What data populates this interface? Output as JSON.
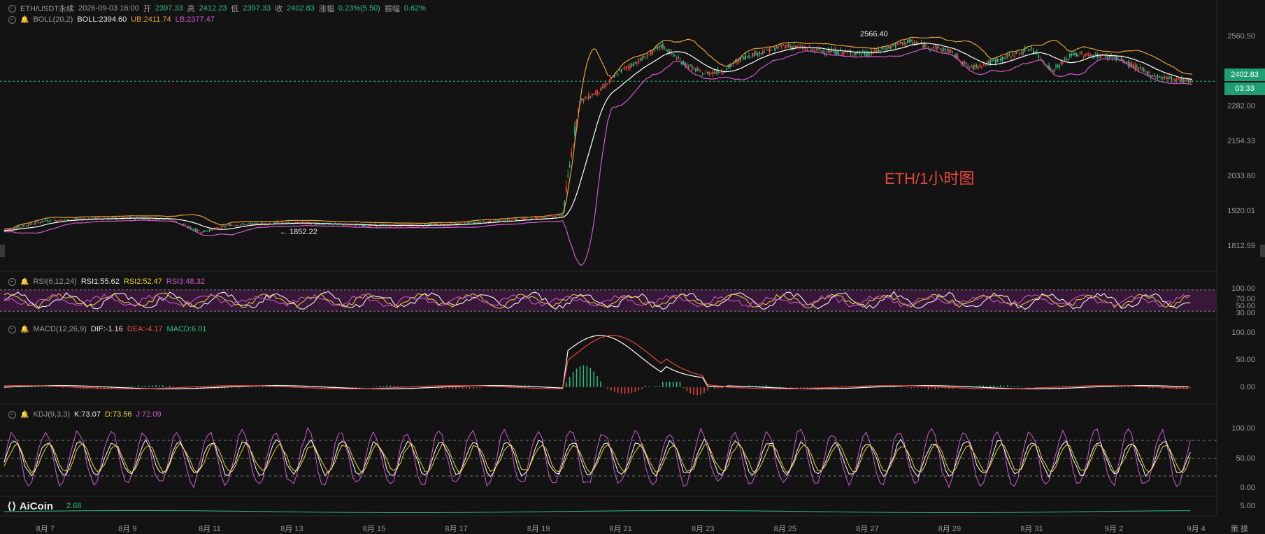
{
  "header": {
    "symbol": "ETH/USDT永续",
    "datetime": "2026-09-03 16:00",
    "open_label": "开",
    "open": "2397.33",
    "high_label": "高",
    "high": "2412.23",
    "low_label": "低",
    "low": "2397.33",
    "close_label": "收",
    "close": "2402.83",
    "change_label": "涨幅",
    "change": "0.23%(5.50)",
    "amp_label": "振幅",
    "amp": "0.62%"
  },
  "indicators": {
    "boll": {
      "name": "BOLL(20,2)",
      "mid": "BOLL:2394.60",
      "ub": "UB:2411.74",
      "lb": "LB:2377.47"
    },
    "rsi": {
      "name": "RSI(6,12,24)",
      "rsi1": "RSI1:55.62",
      "rsi2": "RSI2:52.47",
      "rsi3": "RSI3:48.32"
    },
    "macd": {
      "name": "MACD(12,26,9)",
      "dif": "DIF:-1.16",
      "dea": "DEA:-4.17",
      "macd": "MACD:6.01"
    },
    "kdj": {
      "name": "KDJ(9,3,3)",
      "k": "K:73.07",
      "d": "D:73.56",
      "j": "J:72.09"
    },
    "vol_value": "2.68"
  },
  "annotations": {
    "high_mark": "2566.40",
    "low_mark": "← 1852.22",
    "watermark": "ETH/1小时图"
  },
  "price_tag": {
    "price": "2402.83",
    "countdown": "03:33"
  },
  "logo": "AiCoin",
  "settings_label": "策 操",
  "colors": {
    "up": "#2ebd85",
    "down": "#e5473e",
    "mid": "#ffffff",
    "ub": "#e7a33b",
    "lb": "#d05ad0",
    "rsi_band": "#3d1a3d"
  },
  "chart_data": [
    {
      "type": "candlestick",
      "title": "ETH/USDT永续 1H",
      "y_ticks": [
        "2560.50",
        "2282.00",
        "2154.33",
        "2033.80",
        "1920.01",
        "1812.59"
      ],
      "x_ticks": [
        "8月 7",
        "8月 9",
        "8月 11",
        "8月 13",
        "8月 15",
        "8月 17",
        "8月 19",
        "8月 21",
        "8月 23",
        "8月 25",
        "8月 27",
        "8月 29",
        "8月 31",
        "9月 2",
        "9月 4"
      ],
      "ylim": [
        1780,
        2600
      ],
      "close_series": [
        {
          "day": 6.0,
          "close": 1870
        },
        {
          "day": 7.0,
          "close": 1905
        },
        {
          "day": 8.0,
          "close": 1912
        },
        {
          "day": 9.0,
          "close": 1915
        },
        {
          "day": 10.0,
          "close": 1912
        },
        {
          "day": 10.8,
          "close": 1865
        },
        {
          "day": 11.5,
          "close": 1890
        },
        {
          "day": 12.0,
          "close": 1893
        },
        {
          "day": 13.0,
          "close": 1898
        },
        {
          "day": 14.0,
          "close": 1892
        },
        {
          "day": 15.0,
          "close": 1888
        },
        {
          "day": 16.0,
          "close": 1890
        },
        {
          "day": 17.0,
          "close": 1893
        },
        {
          "day": 18.0,
          "close": 1905
        },
        {
          "day": 19.0,
          "close": 1915
        },
        {
          "day": 19.6,
          "close": 1925
        },
        {
          "day": 19.8,
          "close": 2150
        },
        {
          "day": 20.0,
          "close": 2330
        },
        {
          "day": 20.5,
          "close": 2370
        },
        {
          "day": 21.0,
          "close": 2440
        },
        {
          "day": 21.5,
          "close": 2480
        },
        {
          "day": 22.0,
          "close": 2530
        },
        {
          "day": 22.5,
          "close": 2470
        },
        {
          "day": 23.0,
          "close": 2430
        },
        {
          "day": 23.5,
          "close": 2440
        },
        {
          "day": 24.0,
          "close": 2490
        },
        {
          "day": 25.0,
          "close": 2530
        },
        {
          "day": 26.0,
          "close": 2510
        },
        {
          "day": 27.0,
          "close": 2500
        },
        {
          "day": 28.0,
          "close": 2545
        },
        {
          "day": 29.0,
          "close": 2510
        },
        {
          "day": 29.5,
          "close": 2450
        },
        {
          "day": 30.0,
          "close": 2470
        },
        {
          "day": 31.0,
          "close": 2520
        },
        {
          "day": 31.5,
          "close": 2440
        },
        {
          "day": 32.0,
          "close": 2500
        },
        {
          "day": 33.0,
          "close": 2490
        },
        {
          "day": 34.0,
          "close": 2420
        },
        {
          "day": 34.9,
          "close": 2402.83
        }
      ],
      "high_mark": 2566.4,
      "low_mark": 1852.22,
      "last_price": 2402.83
    },
    {
      "type": "line",
      "title": "RSI(6,12,24)",
      "y_ticks": [
        "100.00",
        "70.00",
        "50.00",
        "30.00"
      ],
      "levels": [
        70,
        30
      ]
    },
    {
      "type": "bar",
      "title": "MACD(12,26,9)",
      "y_ticks": [
        "100.00",
        "50.00",
        "0.00"
      ]
    },
    {
      "type": "line",
      "title": "KDJ(9,3,3)",
      "y_ticks": [
        "100.00",
        "50.00",
        "0.00"
      ],
      "levels": [
        80,
        50,
        20
      ]
    },
    {
      "type": "line",
      "title": "VOL",
      "y_ticks": [
        "5.00"
      ]
    }
  ]
}
